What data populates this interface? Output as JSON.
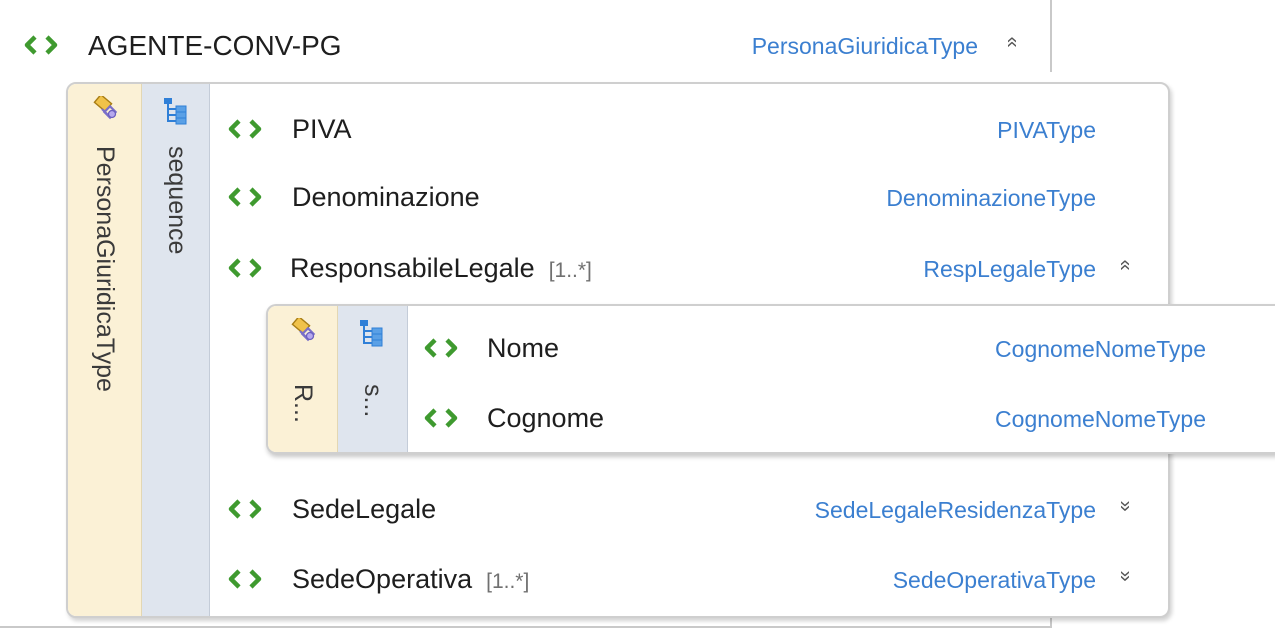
{
  "root": {
    "name": "AGENTE-CONV-PG",
    "type": "PersonaGiuridicaType",
    "expand_icon": "chevron-up-double-icon"
  },
  "compositor": {
    "type_label": "PersonaGiuridicaType",
    "sequence_label": "sequence"
  },
  "elements": [
    {
      "name": "PIVA",
      "mult": "",
      "type": "PIVAType"
    },
    {
      "name": "Denominazione",
      "mult": "",
      "type": "DenominazioneType"
    },
    {
      "name": "ResponsabileLegale",
      "mult": "[1..*]",
      "type": "RespLegaleType",
      "expand_icon": "chevron-up-double-icon"
    },
    {
      "name": "SedeLegale",
      "mult": "",
      "type": "SedeLegaleResidenzaType",
      "expand_icon": "chevron-down-double-icon"
    },
    {
      "name": "SedeOperativa",
      "mult": "[1..*]",
      "type": "SedeOperativaType",
      "expand_icon": "chevron-down-double-icon"
    }
  ],
  "nested": {
    "type_label": "R...",
    "sequence_label": "s...",
    "elements": [
      {
        "name": "Nome",
        "type": "CognomeNomeType"
      },
      {
        "name": "Cognome",
        "type": "CognomeNomeType"
      }
    ]
  },
  "glyphs": {
    "chevron_up": "«",
    "chevron_down": "»"
  },
  "colors": {
    "element_icon": "#3f9a2f",
    "type_link": "#3b7fd0",
    "type_panel": "#fbf1d6",
    "sequence_panel": "#dfe5ee"
  }
}
